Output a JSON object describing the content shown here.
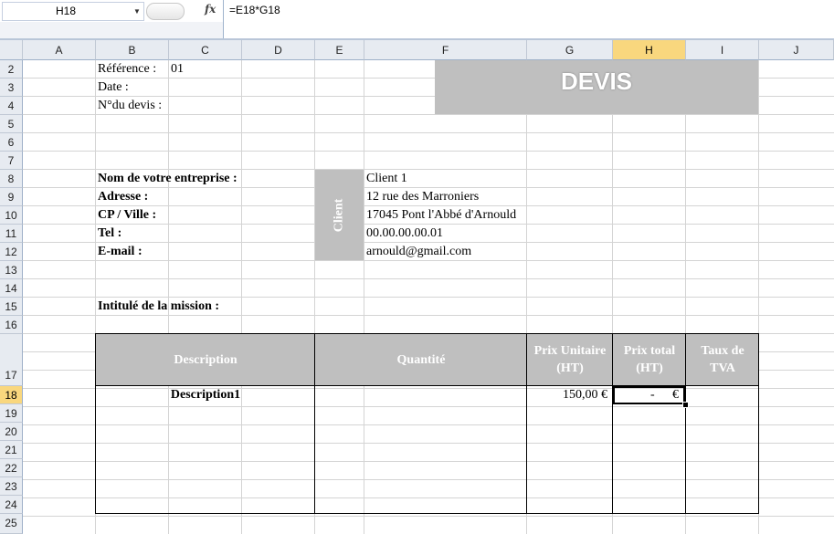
{
  "formula_bar": {
    "name_box": "H18",
    "fx_label": "fx",
    "formula": "=E18*G18"
  },
  "columns": [
    "A",
    "B",
    "C",
    "D",
    "E",
    "F",
    "G",
    "H",
    "I",
    "J"
  ],
  "selected_column": "H",
  "rows": [
    "2",
    "3",
    "4",
    "5",
    "6",
    "7",
    "8",
    "9",
    "10",
    "11",
    "12",
    "13",
    "14",
    "15",
    "16",
    "17",
    "18",
    "19",
    "20",
    "21",
    "22",
    "23",
    "24",
    "25"
  ],
  "selected_row": "18",
  "header_info": {
    "reference_label": "Référence :",
    "reference_value": "01",
    "date_label": "Date :",
    "devis_no_label": "N°du devis :"
  },
  "title": "DEVIS",
  "company": {
    "name_label": "Nom de votre entreprise :",
    "address_label": "Adresse :",
    "cp_label": "CP / Ville :",
    "tel_label": "Tel :",
    "email_label": "E-mail :"
  },
  "client": {
    "label": "Client",
    "name": "Client 1",
    "address": "12 rue des Marroniers",
    "city": "17045 Pont l'Abbé d'Arnould",
    "tel": "00.00.00.00.01",
    "email": "arnould@gmail.com"
  },
  "mission_label": "Intitulé de la mission :",
  "table": {
    "headers": {
      "description": "Description",
      "quantity": "Quantité",
      "unit_price": "Prix Unitaire (HT)",
      "total_price": "Prix total (HT)",
      "vat_rate": "Taux de TVA"
    },
    "rows": [
      {
        "description": "Description1",
        "unit_price": "150,00 €",
        "total_dash": "-",
        "total_currency": "€"
      }
    ]
  },
  "colors": {
    "header_gray": "#bfbfbf",
    "selection_header": "#f9d77e",
    "gridline": "#d4d4d4"
  }
}
